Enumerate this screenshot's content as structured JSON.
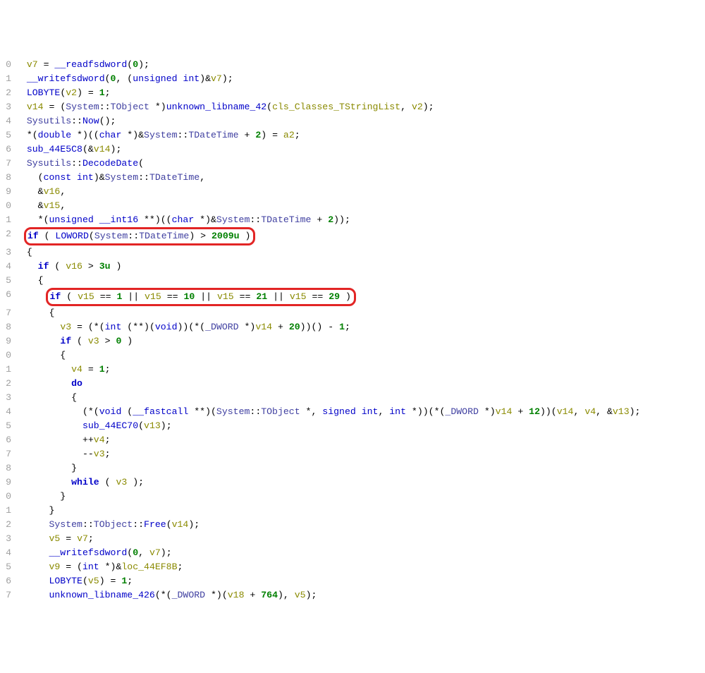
{
  "lines": [
    {
      "n": "0",
      "tokens": [
        {
          "t": "  ",
          "c": "c-op"
        },
        {
          "t": "v7",
          "c": "c-var"
        },
        {
          "t": " = ",
          "c": "c-op"
        },
        {
          "t": "__readfsdword",
          "c": "c-fn"
        },
        {
          "t": "(",
          "c": "c-pun"
        },
        {
          "t": "0",
          "c": "c-num"
        },
        {
          "t": ");",
          "c": "c-pun"
        }
      ]
    },
    {
      "n": "1",
      "tokens": [
        {
          "t": "  ",
          "c": "c-op"
        },
        {
          "t": "__writefsdword",
          "c": "c-fn"
        },
        {
          "t": "(",
          "c": "c-pun"
        },
        {
          "t": "0",
          "c": "c-num"
        },
        {
          "t": ", (",
          "c": "c-pun"
        },
        {
          "t": "unsigned int",
          "c": "c-type"
        },
        {
          "t": ")&",
          "c": "c-pun"
        },
        {
          "t": "v7",
          "c": "c-var"
        },
        {
          "t": ");",
          "c": "c-pun"
        }
      ]
    },
    {
      "n": "2",
      "tokens": [
        {
          "t": "  ",
          "c": "c-op"
        },
        {
          "t": "LOBYTE",
          "c": "c-fn"
        },
        {
          "t": "(",
          "c": "c-pun"
        },
        {
          "t": "v2",
          "c": "c-var"
        },
        {
          "t": ") = ",
          "c": "c-pun"
        },
        {
          "t": "1",
          "c": "c-num"
        },
        {
          "t": ";",
          "c": "c-pun"
        }
      ]
    },
    {
      "n": "3",
      "tokens": [
        {
          "t": "  ",
          "c": "c-op"
        },
        {
          "t": "v14",
          "c": "c-var"
        },
        {
          "t": " = (",
          "c": "c-pun"
        },
        {
          "t": "System",
          "c": "c-ty2"
        },
        {
          "t": "::",
          "c": "c-pun"
        },
        {
          "t": "TObject",
          "c": "c-ty2"
        },
        {
          "t": " *)",
          "c": "c-pun"
        },
        {
          "t": "unknown_libname_42",
          "c": "c-fn"
        },
        {
          "t": "(",
          "c": "c-pun"
        },
        {
          "t": "cls_Classes_TStringList",
          "c": "c-var"
        },
        {
          "t": ", ",
          "c": "c-pun"
        },
        {
          "t": "v2",
          "c": "c-var"
        },
        {
          "t": ");",
          "c": "c-pun"
        }
      ]
    },
    {
      "n": "4",
      "tokens": [
        {
          "t": "  ",
          "c": "c-op"
        },
        {
          "t": "Sysutils",
          "c": "c-ty2"
        },
        {
          "t": "::",
          "c": "c-pun"
        },
        {
          "t": "Now",
          "c": "c-fn"
        },
        {
          "t": "();",
          "c": "c-pun"
        }
      ]
    },
    {
      "n": "5",
      "tokens": [
        {
          "t": "  *(",
          "c": "c-pun"
        },
        {
          "t": "double",
          "c": "c-type"
        },
        {
          "t": " *)((",
          "c": "c-pun"
        },
        {
          "t": "char",
          "c": "c-type"
        },
        {
          "t": " *)&",
          "c": "c-pun"
        },
        {
          "t": "System",
          "c": "c-ty2"
        },
        {
          "t": "::",
          "c": "c-pun"
        },
        {
          "t": "TDateTime",
          "c": "c-ty2"
        },
        {
          "t": " + ",
          "c": "c-pun"
        },
        {
          "t": "2",
          "c": "c-num"
        },
        {
          "t": ") = ",
          "c": "c-pun"
        },
        {
          "t": "a2",
          "c": "c-var"
        },
        {
          "t": ";",
          "c": "c-pun"
        }
      ]
    },
    {
      "n": "6",
      "tokens": [
        {
          "t": "  ",
          "c": "c-op"
        },
        {
          "t": "sub_44E5C8",
          "c": "c-fn"
        },
        {
          "t": "(&",
          "c": "c-pun"
        },
        {
          "t": "v14",
          "c": "c-var"
        },
        {
          "t": ");",
          "c": "c-pun"
        }
      ]
    },
    {
      "n": "7",
      "tokens": [
        {
          "t": "  ",
          "c": "c-op"
        },
        {
          "t": "Sysutils",
          "c": "c-ty2"
        },
        {
          "t": "::",
          "c": "c-pun"
        },
        {
          "t": "DecodeDate",
          "c": "c-fn"
        },
        {
          "t": "(",
          "c": "c-pun"
        }
      ]
    },
    {
      "n": "8",
      "tokens": [
        {
          "t": "    (",
          "c": "c-pun"
        },
        {
          "t": "const int",
          "c": "c-type"
        },
        {
          "t": ")&",
          "c": "c-pun"
        },
        {
          "t": "System",
          "c": "c-ty2"
        },
        {
          "t": "::",
          "c": "c-pun"
        },
        {
          "t": "TDateTime",
          "c": "c-ty2"
        },
        {
          "t": ",",
          "c": "c-pun"
        }
      ]
    },
    {
      "n": "9",
      "tokens": [
        {
          "t": "    &",
          "c": "c-pun"
        },
        {
          "t": "v16",
          "c": "c-var"
        },
        {
          "t": ",",
          "c": "c-pun"
        }
      ]
    },
    {
      "n": "0",
      "tokens": [
        {
          "t": "    &",
          "c": "c-pun"
        },
        {
          "t": "v15",
          "c": "c-var"
        },
        {
          "t": ",",
          "c": "c-pun"
        }
      ]
    },
    {
      "n": "1",
      "tokens": [
        {
          "t": "    *(",
          "c": "c-pun"
        },
        {
          "t": "unsigned __int16",
          "c": "c-type"
        },
        {
          "t": " **)((",
          "c": "c-pun"
        },
        {
          "t": "char",
          "c": "c-type"
        },
        {
          "t": " *)&",
          "c": "c-pun"
        },
        {
          "t": "System",
          "c": "c-ty2"
        },
        {
          "t": "::",
          "c": "c-pun"
        },
        {
          "t": "TDateTime",
          "c": "c-ty2"
        },
        {
          "t": " + ",
          "c": "c-pun"
        },
        {
          "t": "2",
          "c": "c-num"
        },
        {
          "t": "));",
          "c": "c-pun"
        }
      ]
    },
    {
      "n": "2",
      "hl": true,
      "tokens": [
        {
          "t": "  ",
          "c": "c-op"
        }
      ],
      "hlTokens": [
        {
          "t": "if",
          "c": "c-kw"
        },
        {
          "t": " ( ",
          "c": "c-pun"
        },
        {
          "t": "LOWORD",
          "c": "c-fn"
        },
        {
          "t": "(",
          "c": "c-pun"
        },
        {
          "t": "System",
          "c": "c-ty2"
        },
        {
          "t": "::",
          "c": "c-pun"
        },
        {
          "t": "TDateTime",
          "c": "c-ty2"
        },
        {
          "t": ") > ",
          "c": "c-pun"
        },
        {
          "t": "2009u",
          "c": "c-num"
        },
        {
          "t": " )",
          "c": "c-pun"
        }
      ]
    },
    {
      "n": "3",
      "tokens": [
        {
          "t": "  {",
          "c": "c-pun"
        }
      ]
    },
    {
      "n": "4",
      "tokens": [
        {
          "t": "    ",
          "c": "c-op"
        },
        {
          "t": "if",
          "c": "c-kw"
        },
        {
          "t": " ( ",
          "c": "c-pun"
        },
        {
          "t": "v16",
          "c": "c-var"
        },
        {
          "t": " > ",
          "c": "c-pun"
        },
        {
          "t": "3u",
          "c": "c-num"
        },
        {
          "t": " )",
          "c": "c-pun"
        }
      ]
    },
    {
      "n": "5",
      "tokens": [
        {
          "t": "    {",
          "c": "c-pun"
        }
      ]
    },
    {
      "n": "6",
      "hl": true,
      "tokens": [
        {
          "t": "      ",
          "c": "c-op"
        }
      ],
      "hlTokens": [
        {
          "t": "if",
          "c": "c-kw"
        },
        {
          "t": " ( ",
          "c": "c-pun"
        },
        {
          "t": "v15",
          "c": "c-var"
        },
        {
          "t": " == ",
          "c": "c-pun"
        },
        {
          "t": "1",
          "c": "c-num"
        },
        {
          "t": " || ",
          "c": "c-pun"
        },
        {
          "t": "v15",
          "c": "c-var"
        },
        {
          "t": " == ",
          "c": "c-pun"
        },
        {
          "t": "10",
          "c": "c-num"
        },
        {
          "t": " || ",
          "c": "c-pun"
        },
        {
          "t": "v15",
          "c": "c-var"
        },
        {
          "t": " == ",
          "c": "c-pun"
        },
        {
          "t": "21",
          "c": "c-num"
        },
        {
          "t": " || ",
          "c": "c-pun"
        },
        {
          "t": "v15",
          "c": "c-var"
        },
        {
          "t": " == ",
          "c": "c-pun"
        },
        {
          "t": "29",
          "c": "c-num"
        },
        {
          "t": " )",
          "c": "c-pun"
        }
      ]
    },
    {
      "n": "7",
      "tokens": [
        {
          "t": "      {",
          "c": "c-pun"
        }
      ]
    },
    {
      "n": "8",
      "tokens": [
        {
          "t": "        ",
          "c": "c-op"
        },
        {
          "t": "v3",
          "c": "c-var"
        },
        {
          "t": " = (*(",
          "c": "c-pun"
        },
        {
          "t": "int",
          "c": "c-type"
        },
        {
          "t": " (**)(",
          "c": "c-pun"
        },
        {
          "t": "void",
          "c": "c-type"
        },
        {
          "t": "))(*(",
          "c": "c-pun"
        },
        {
          "t": "_DWORD",
          "c": "c-ty2"
        },
        {
          "t": " *)",
          "c": "c-pun"
        },
        {
          "t": "v14",
          "c": "c-var"
        },
        {
          "t": " + ",
          "c": "c-pun"
        },
        {
          "t": "20",
          "c": "c-num"
        },
        {
          "t": "))() - ",
          "c": "c-pun"
        },
        {
          "t": "1",
          "c": "c-num"
        },
        {
          "t": ";",
          "c": "c-pun"
        }
      ]
    },
    {
      "n": "9",
      "tokens": [
        {
          "t": "        ",
          "c": "c-op"
        },
        {
          "t": "if",
          "c": "c-kw"
        },
        {
          "t": " ( ",
          "c": "c-pun"
        },
        {
          "t": "v3",
          "c": "c-var"
        },
        {
          "t": " > ",
          "c": "c-pun"
        },
        {
          "t": "0",
          "c": "c-num"
        },
        {
          "t": " )",
          "c": "c-pun"
        }
      ]
    },
    {
      "n": "0",
      "tokens": [
        {
          "t": "        {",
          "c": "c-pun"
        }
      ]
    },
    {
      "n": "1",
      "tokens": [
        {
          "t": "          ",
          "c": "c-op"
        },
        {
          "t": "v4",
          "c": "c-var"
        },
        {
          "t": " = ",
          "c": "c-pun"
        },
        {
          "t": "1",
          "c": "c-num"
        },
        {
          "t": ";",
          "c": "c-pun"
        }
      ]
    },
    {
      "n": "2",
      "tokens": [
        {
          "t": "          ",
          "c": "c-op"
        },
        {
          "t": "do",
          "c": "c-kw"
        }
      ]
    },
    {
      "n": "3",
      "tokens": [
        {
          "t": "          {",
          "c": "c-pun"
        }
      ]
    },
    {
      "n": "4",
      "tokens": [
        {
          "t": "            (*(",
          "c": "c-pun"
        },
        {
          "t": "void",
          "c": "c-type"
        },
        {
          "t": " (",
          "c": "c-pun"
        },
        {
          "t": "__fastcall",
          "c": "c-type"
        },
        {
          "t": " **)(",
          "c": "c-pun"
        },
        {
          "t": "System",
          "c": "c-ty2"
        },
        {
          "t": "::",
          "c": "c-pun"
        },
        {
          "t": "TObject",
          "c": "c-ty2"
        },
        {
          "t": " *, ",
          "c": "c-pun"
        },
        {
          "t": "signed int",
          "c": "c-type"
        },
        {
          "t": ", ",
          "c": "c-pun"
        },
        {
          "t": "int",
          "c": "c-type"
        },
        {
          "t": " *))(*(",
          "c": "c-pun"
        },
        {
          "t": "_DWORD",
          "c": "c-ty2"
        },
        {
          "t": " *)",
          "c": "c-pun"
        },
        {
          "t": "v14",
          "c": "c-var"
        },
        {
          "t": " + ",
          "c": "c-pun"
        },
        {
          "t": "12",
          "c": "c-num"
        },
        {
          "t": "))(",
          "c": "c-pun"
        },
        {
          "t": "v14",
          "c": "c-var"
        },
        {
          "t": ", ",
          "c": "c-pun"
        },
        {
          "t": "v4",
          "c": "c-var"
        },
        {
          "t": ", &",
          "c": "c-pun"
        },
        {
          "t": "v13",
          "c": "c-var"
        },
        {
          "t": ");",
          "c": "c-pun"
        }
      ]
    },
    {
      "n": "5",
      "tokens": [
        {
          "t": "            ",
          "c": "c-op"
        },
        {
          "t": "sub_44EC70",
          "c": "c-fn"
        },
        {
          "t": "(",
          "c": "c-pun"
        },
        {
          "t": "v13",
          "c": "c-var"
        },
        {
          "t": ");",
          "c": "c-pun"
        }
      ]
    },
    {
      "n": "6",
      "tokens": [
        {
          "t": "            ++",
          "c": "c-pun"
        },
        {
          "t": "v4",
          "c": "c-var"
        },
        {
          "t": ";",
          "c": "c-pun"
        }
      ]
    },
    {
      "n": "7",
      "tokens": [
        {
          "t": "            --",
          "c": "c-pun"
        },
        {
          "t": "v3",
          "c": "c-var"
        },
        {
          "t": ";",
          "c": "c-pun"
        }
      ]
    },
    {
      "n": "8",
      "tokens": [
        {
          "t": "          }",
          "c": "c-pun"
        }
      ]
    },
    {
      "n": "9",
      "tokens": [
        {
          "t": "          ",
          "c": "c-op"
        },
        {
          "t": "while",
          "c": "c-kw"
        },
        {
          "t": " ( ",
          "c": "c-pun"
        },
        {
          "t": "v3",
          "c": "c-var"
        },
        {
          "t": " );",
          "c": "c-pun"
        }
      ]
    },
    {
      "n": "0",
      "tokens": [
        {
          "t": "        }",
          "c": "c-pun"
        }
      ]
    },
    {
      "n": "1",
      "tokens": [
        {
          "t": "      }",
          "c": "c-pun"
        }
      ]
    },
    {
      "n": "2",
      "tokens": [
        {
          "t": "      ",
          "c": "c-op"
        },
        {
          "t": "System",
          "c": "c-ty2"
        },
        {
          "t": "::",
          "c": "c-pun"
        },
        {
          "t": "TObject",
          "c": "c-ty2"
        },
        {
          "t": "::",
          "c": "c-pun"
        },
        {
          "t": "Free",
          "c": "c-fn"
        },
        {
          "t": "(",
          "c": "c-pun"
        },
        {
          "t": "v14",
          "c": "c-var"
        },
        {
          "t": ");",
          "c": "c-pun"
        }
      ]
    },
    {
      "n": "3",
      "tokens": [
        {
          "t": "      ",
          "c": "c-op"
        },
        {
          "t": "v5",
          "c": "c-var"
        },
        {
          "t": " = ",
          "c": "c-pun"
        },
        {
          "t": "v7",
          "c": "c-var"
        },
        {
          "t": ";",
          "c": "c-pun"
        }
      ]
    },
    {
      "n": "4",
      "tokens": [
        {
          "t": "      ",
          "c": "c-op"
        },
        {
          "t": "__writefsdword",
          "c": "c-fn"
        },
        {
          "t": "(",
          "c": "c-pun"
        },
        {
          "t": "0",
          "c": "c-num"
        },
        {
          "t": ", ",
          "c": "c-pun"
        },
        {
          "t": "v7",
          "c": "c-var"
        },
        {
          "t": ");",
          "c": "c-pun"
        }
      ]
    },
    {
      "n": "5",
      "tokens": [
        {
          "t": "      ",
          "c": "c-op"
        },
        {
          "t": "v9",
          "c": "c-var"
        },
        {
          "t": " = (",
          "c": "c-pun"
        },
        {
          "t": "int",
          "c": "c-type"
        },
        {
          "t": " *)&",
          "c": "c-pun"
        },
        {
          "t": "loc_44EF8B",
          "c": "c-var"
        },
        {
          "t": ";",
          "c": "c-pun"
        }
      ]
    },
    {
      "n": "6",
      "tokens": [
        {
          "t": "      ",
          "c": "c-op"
        },
        {
          "t": "LOBYTE",
          "c": "c-fn"
        },
        {
          "t": "(",
          "c": "c-pun"
        },
        {
          "t": "v5",
          "c": "c-var"
        },
        {
          "t": ") = ",
          "c": "c-pun"
        },
        {
          "t": "1",
          "c": "c-num"
        },
        {
          "t": ";",
          "c": "c-pun"
        }
      ]
    },
    {
      "n": "7",
      "tokens": [
        {
          "t": "      ",
          "c": "c-op"
        },
        {
          "t": "unknown_libname_426",
          "c": "c-fn"
        },
        {
          "t": "(*(",
          "c": "c-pun"
        },
        {
          "t": "_DWORD",
          "c": "c-ty2"
        },
        {
          "t": " *)(",
          "c": "c-pun"
        },
        {
          "t": "v18",
          "c": "c-var"
        },
        {
          "t": " + ",
          "c": "c-pun"
        },
        {
          "t": "764",
          "c": "c-num"
        },
        {
          "t": "), ",
          "c": "c-pun"
        },
        {
          "t": "v5",
          "c": "c-var"
        },
        {
          "t": ");",
          "c": "c-pun"
        }
      ]
    }
  ]
}
